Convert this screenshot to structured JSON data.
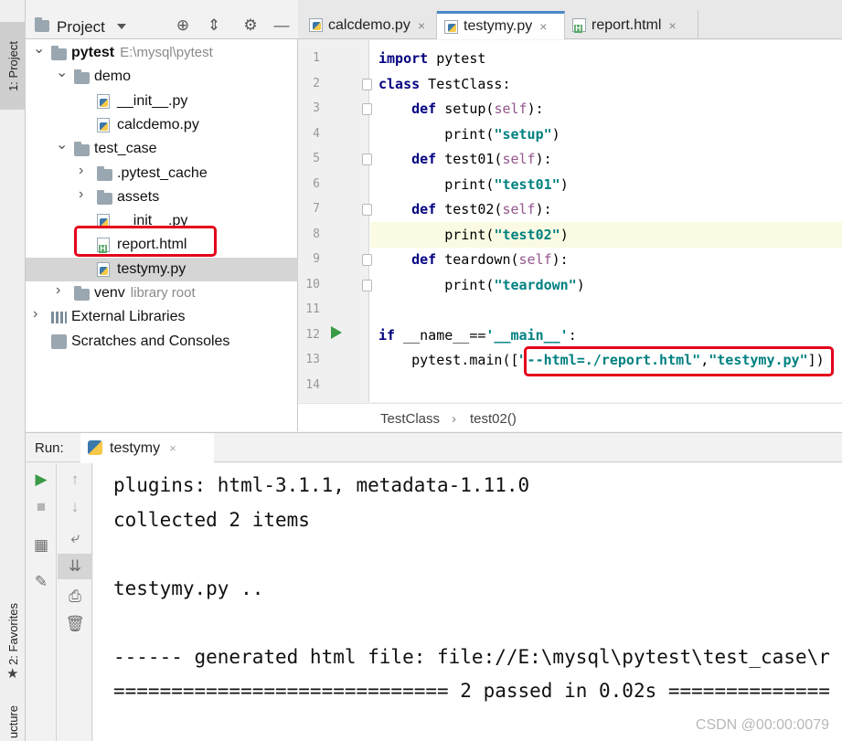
{
  "left_stripe": {
    "project_tab": "1: Project",
    "favorites_tab": "2: Favorites",
    "structure_tab": "ucture"
  },
  "project_panel": {
    "title": "Project",
    "tree": [
      {
        "label": "pytest",
        "path": "E:\\mysql\\pytest",
        "type": "folder",
        "expanded": true,
        "bold": true
      },
      {
        "label": "demo",
        "type": "folder",
        "expanded": true
      },
      {
        "label": "__init__.py",
        "type": "py"
      },
      {
        "label": "calcdemo.py",
        "type": "py"
      },
      {
        "label": "test_case",
        "type": "folder",
        "expanded": true
      },
      {
        "label": ".pytest_cache",
        "type": "folder",
        "expanded": false
      },
      {
        "label": "assets",
        "type": "folder",
        "expanded": false
      },
      {
        "label": "__init__.py",
        "type": "py"
      },
      {
        "label": "report.html",
        "type": "html"
      },
      {
        "label": "testymy.py",
        "type": "py",
        "selected": true
      },
      {
        "label": "venv",
        "sub": "library root",
        "type": "folder",
        "expanded": false
      },
      {
        "label": "External Libraries",
        "type": "libs",
        "expanded": false
      },
      {
        "label": "Scratches and Consoles",
        "type": "scratch"
      }
    ]
  },
  "editor_tabs": [
    {
      "label": "calcdemo.py",
      "active": false
    },
    {
      "label": "testymy.py",
      "active": true
    },
    {
      "label": "report.html",
      "active": false
    }
  ],
  "editor": {
    "line_numbers": [
      "1",
      "2",
      "3",
      "4",
      "5",
      "6",
      "7",
      "8",
      "9",
      "10",
      "11",
      "12",
      "13",
      "14"
    ],
    "lines": [
      [
        {
          "t": "import",
          "k": "kw"
        },
        {
          "t": " pytest",
          "k": ""
        }
      ],
      [
        {
          "t": "class",
          "k": "kw"
        },
        {
          "t": " TestClass:",
          "k": ""
        }
      ],
      [
        {
          "t": "    ",
          "k": ""
        },
        {
          "t": "def",
          "k": "kw"
        },
        {
          "t": " setup(",
          "k": ""
        },
        {
          "t": "self",
          "k": "slf"
        },
        {
          "t": "):",
          "k": ""
        }
      ],
      [
        {
          "t": "        print(",
          "k": ""
        },
        {
          "t": "\"setup\"",
          "k": "str"
        },
        {
          "t": ")",
          "k": ""
        }
      ],
      [
        {
          "t": "    ",
          "k": ""
        },
        {
          "t": "def",
          "k": "kw"
        },
        {
          "t": " test01(",
          "k": ""
        },
        {
          "t": "self",
          "k": "slf"
        },
        {
          "t": "):",
          "k": ""
        }
      ],
      [
        {
          "t": "        print(",
          "k": ""
        },
        {
          "t": "\"test01\"",
          "k": "str"
        },
        {
          "t": ")",
          "k": ""
        }
      ],
      [
        {
          "t": "    ",
          "k": ""
        },
        {
          "t": "def",
          "k": "kw"
        },
        {
          "t": " test02(",
          "k": ""
        },
        {
          "t": "self",
          "k": "slf"
        },
        {
          "t": "):",
          "k": ""
        }
      ],
      [
        {
          "t": "        print(",
          "k": ""
        },
        {
          "t": "\"test02\"",
          "k": "str"
        },
        {
          "t": ")",
          "k": ""
        }
      ],
      [
        {
          "t": "    ",
          "k": ""
        },
        {
          "t": "def",
          "k": "kw"
        },
        {
          "t": " teardown(",
          "k": ""
        },
        {
          "t": "self",
          "k": "slf"
        },
        {
          "t": "):",
          "k": ""
        }
      ],
      [
        {
          "t": "        print(",
          "k": ""
        },
        {
          "t": "\"teardown\"",
          "k": "str"
        },
        {
          "t": ")",
          "k": ""
        }
      ],
      [
        {
          "t": "",
          "k": ""
        }
      ],
      [
        {
          "t": "if",
          "k": "kw"
        },
        {
          "t": " __name__==",
          "k": ""
        },
        {
          "t": "'__main__'",
          "k": "str"
        },
        {
          "t": ":",
          "k": ""
        }
      ],
      [
        {
          "t": "    pytest.main([",
          "k": ""
        },
        {
          "t": "\"--html=./report.html\"",
          "k": "str"
        },
        {
          "t": ",",
          "k": ""
        },
        {
          "t": "\"testymy.py\"",
          "k": "str"
        },
        {
          "t": "])",
          "k": ""
        }
      ],
      [
        {
          "t": "",
          "k": ""
        }
      ]
    ],
    "breadcrumb": [
      "TestClass",
      "test02()"
    ],
    "breadcrumb_sep": "›"
  },
  "run_panel": {
    "label": "Run:",
    "tab": "testymy",
    "console_lines": [
      "plugins: html-3.1.1, metadata-1.11.0",
      "collected 2 items",
      "",
      "testymy.py ..",
      "",
      "------ generated html file: file://E:\\mysql\\pytest\\test_case\\r",
      "============================= 2 passed in 0.02s =============="
    ]
  },
  "watermark": "CSDN @00:00:0079",
  "colors": {
    "keyword": "#000080",
    "string": "#008080",
    "self": "#94558d",
    "highlight_box": "#e4001a",
    "run_green": "#3a9a46"
  },
  "icons": [
    "target-icon",
    "collapse-icon",
    "gear-icon",
    "minimize-icon",
    "run-icon",
    "stop-icon",
    "rerun-icon",
    "pin-icon",
    "up-arrow-icon",
    "down-arrow-icon",
    "soft-wrap-icon",
    "scroll-end-icon",
    "print-icon",
    "trash-icon",
    "star-icon"
  ]
}
